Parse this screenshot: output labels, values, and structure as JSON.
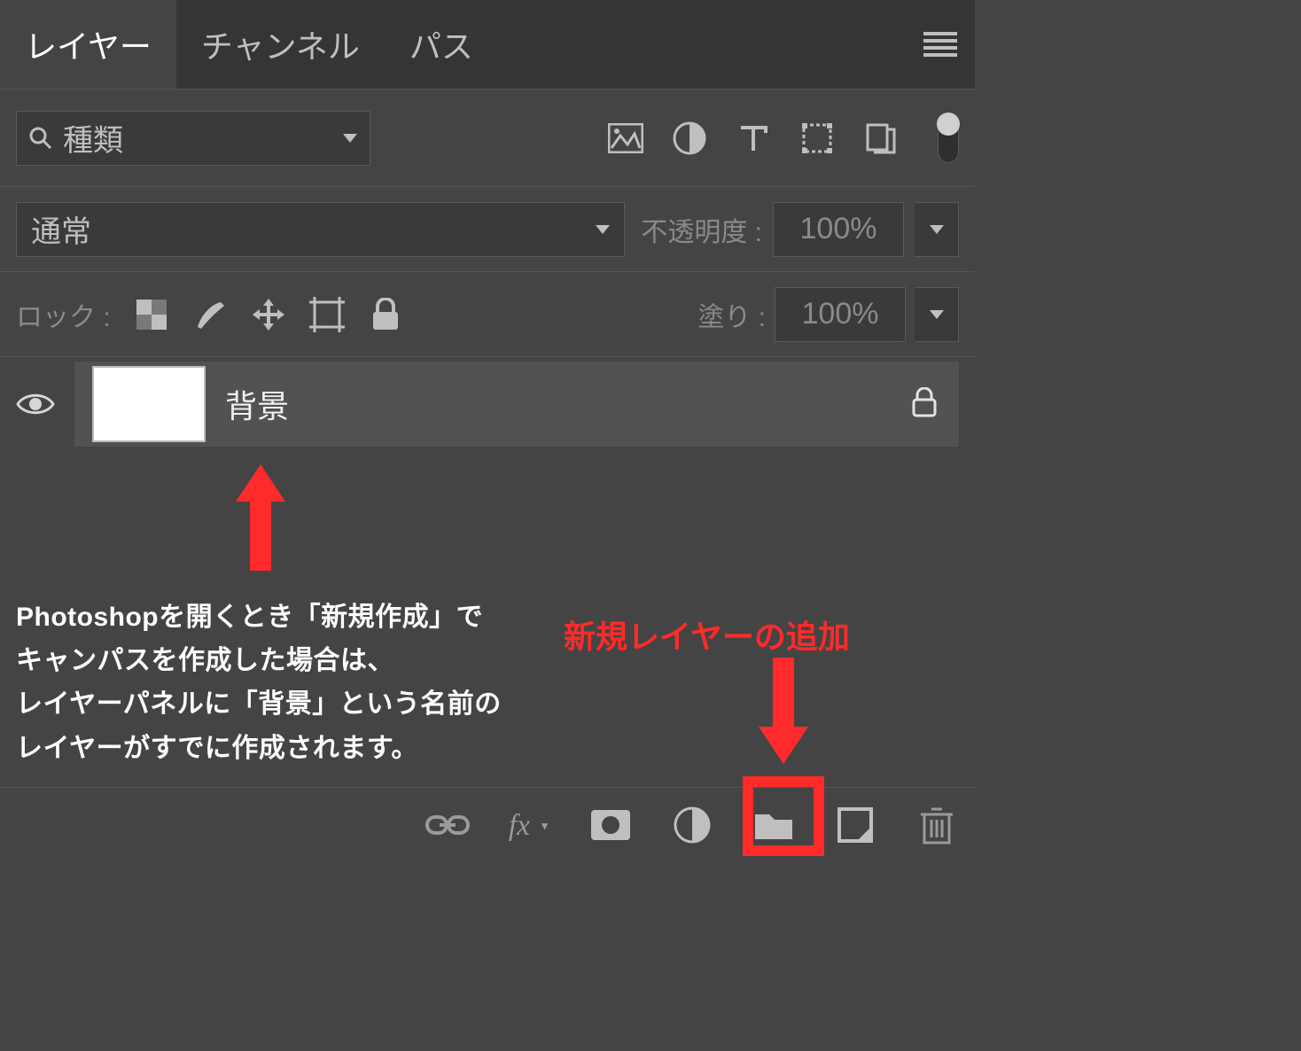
{
  "tabs": {
    "layers": "レイヤー",
    "channels": "チャンネル",
    "paths": "パス"
  },
  "filter": {
    "kind_label": "種類"
  },
  "blend": {
    "mode": "通常",
    "opacity_label": "不透明度 :",
    "opacity_value": "100%"
  },
  "lock": {
    "label": "ロック :",
    "fill_label": "塗り :",
    "fill_value": "100%"
  },
  "layers": [
    {
      "name": "背景",
      "locked": true,
      "visible": true
    }
  ],
  "annotations": {
    "left_text": "Photoshopを開くとき「新規作成」で\nキャンパスを作成した場合は、\nレイヤーパネルに「背景」という名前の\nレイヤーがすでに作成されます。",
    "right_text": "新規レイヤーの追加"
  }
}
